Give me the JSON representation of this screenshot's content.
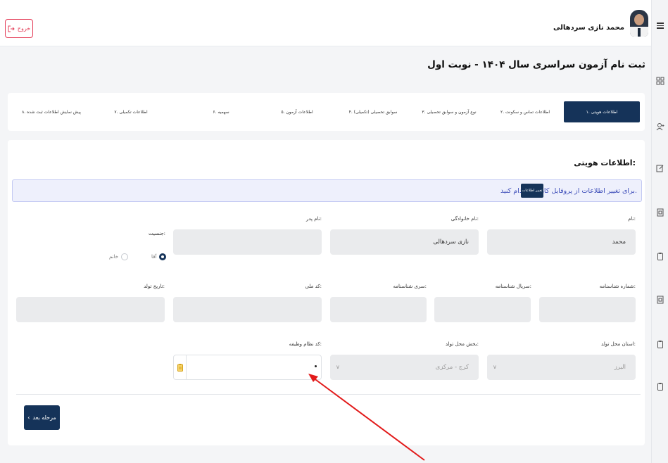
{
  "header": {
    "user_name": "محمد نازی سردهالی",
    "logout_label": "خروج"
  },
  "page": {
    "title": "ثبت نام آزمون سراسری سال ۱۴۰۴ - نوبت اول"
  },
  "steps": [
    {
      "label": "۱. اطلاعات هویتی",
      "active": true
    },
    {
      "label": "۲. اطلاعات تماس و سکونت"
    },
    {
      "label": "۳. نوع آزمون و سوابق تحصیلی"
    },
    {
      "label": "۴. سوابق تحصیلی (تکمیلی)"
    },
    {
      "label": "۵. اطلاعات آزمون"
    },
    {
      "label": "۶. سهمیه"
    },
    {
      "label": "۷. اطلاعات تکمیلی"
    },
    {
      "label": "۸. پیش نمایش اطلاعات ثبت شده"
    }
  ],
  "form": {
    "section_title": "اطلاعات هویتی:",
    "alert_text": "برای تغییر اطلاعات از پروفایل کاربری اقدام کنید.",
    "alert_button": "تغییر اطلاعات",
    "first_name_label": "نام:",
    "first_name_value": "محمد",
    "last_name_label": "نام خانوادگی:",
    "last_name_value": "نازی سردهالی",
    "father_name_label": "نام پدر:",
    "father_name_value": "",
    "gender_label": "جنسیت:",
    "gender_male": "آقا",
    "gender_female": "خانم",
    "id_number_label": "شماره شناسنامه:",
    "id_serial_label": "سریال شناسنامه:",
    "id_series_label": "سری شناسنامه:",
    "national_code_label": "کد ملی:",
    "birth_date_label": "تاریخ تولد:",
    "birth_province_label": "استان محل تولد:",
    "birth_province_value": "البرز",
    "birth_district_label": "بخش محل تولد:",
    "birth_district_value": "کرج - مرکزی",
    "military_code_label": "کد نظام وظیفه:",
    "military_code_value": "",
    "next_button": "مرحله بعد"
  },
  "colors": {
    "primary": "#153359",
    "logout": "#e43f5a",
    "alert_text": "#3b4bb8",
    "annotation_arrow": "#e21a1a"
  }
}
